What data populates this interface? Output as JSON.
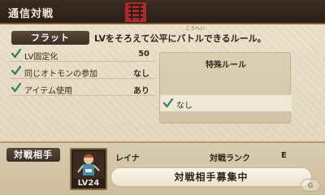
{
  "header": {
    "title": "通信対戦"
  },
  "rule": {
    "name": "フラット",
    "description": "LVをそろえて公平にバトルできるルール。",
    "ruby": "こうへい"
  },
  "settings": [
    {
      "label": "LV固定化",
      "value": "50"
    },
    {
      "label": "同じオトモンの参加",
      "value": "なし"
    },
    {
      "label": "アイテム使用",
      "value": "あり"
    }
  ],
  "special_rule": {
    "title": "特殊ルール",
    "items": [
      {
        "label": "なし"
      }
    ]
  },
  "opponent": {
    "section_label": "対戦相手",
    "level": "LV24",
    "name": "レイナ",
    "rank_label": "対戦ランク",
    "rank": "E",
    "recruit_label": "対戦相手募集中"
  },
  "watermark": "G",
  "colors": {
    "header_bg": "#2a1f17",
    "tab_bg": "#3e3026",
    "check_green": "#2f7a6a",
    "emblem_red": "#b0282c"
  }
}
